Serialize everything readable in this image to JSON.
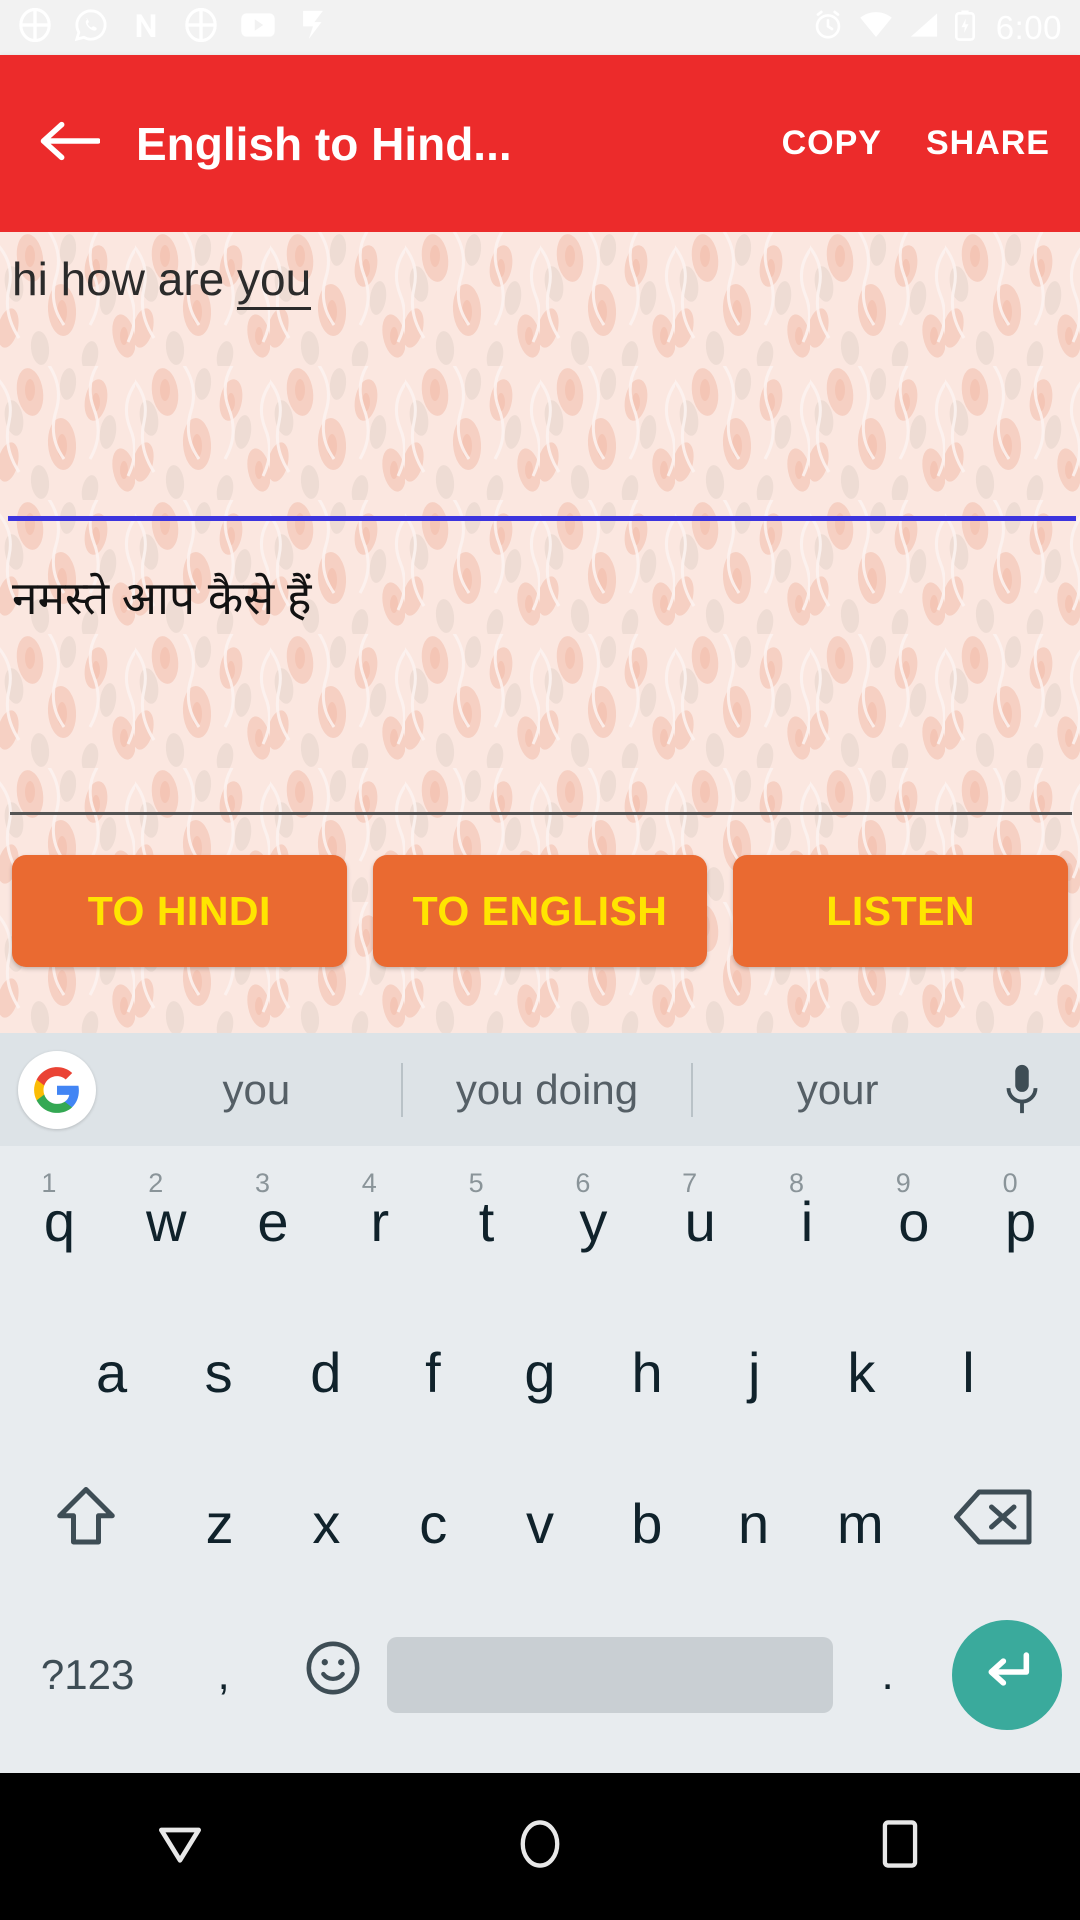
{
  "status_bar": {
    "time": "6:00",
    "notification_icons": [
      "apps-grid-icon",
      "whatsapp-icon",
      "letter-n-icon",
      "apps-grid-icon",
      "youtube-icon",
      "flipboard-icon"
    ],
    "system_icons": [
      "alarm-icon",
      "wifi-icon",
      "signal-icon",
      "battery-icon"
    ],
    "background_color": "#f2f2f2",
    "text_color": "#ffffff"
  },
  "app_bar": {
    "back_label": "back-arrow",
    "title": "English to Hind...",
    "copy_label": "COPY",
    "share_label": "SHARE",
    "background_color": "#ec2b2b",
    "text_color": "#ffffff"
  },
  "translator": {
    "source_text_before": "hi how are ",
    "source_text_composing": "you",
    "target_text": "नमस्ते आप कैसे हैं",
    "divider_color": "#3c34de",
    "bottom_divider_color": "#545454",
    "background_color": "#f9ded6",
    "buttons": [
      {
        "label": "TO HINDI",
        "name": "to-hindi-button"
      },
      {
        "label": "TO ENGLISH",
        "name": "to-english-button"
      },
      {
        "label": "LISTEN",
        "name": "listen-button"
      }
    ],
    "button_bg": "#ea6a31",
    "button_fg": "#ffe500"
  },
  "keyboard": {
    "suggestions": [
      "you",
      "you doing",
      "your"
    ],
    "google_logo": "google-g-icon",
    "mic": "microphone-icon",
    "row1": [
      {
        "key": "q",
        "num": "1"
      },
      {
        "key": "w",
        "num": "2"
      },
      {
        "key": "e",
        "num": "3"
      },
      {
        "key": "r",
        "num": "4"
      },
      {
        "key": "t",
        "num": "5"
      },
      {
        "key": "y",
        "num": "6"
      },
      {
        "key": "u",
        "num": "7"
      },
      {
        "key": "i",
        "num": "8"
      },
      {
        "key": "o",
        "num": "9"
      },
      {
        "key": "p",
        "num": "0"
      }
    ],
    "row2": [
      "a",
      "s",
      "d",
      "f",
      "g",
      "h",
      "j",
      "k",
      "l"
    ],
    "row3": [
      "z",
      "x",
      "c",
      "v",
      "b",
      "n",
      "m"
    ],
    "shift_label": "shift-icon",
    "backspace_label": "backspace-icon",
    "symbols_label": "?123",
    "comma_label": ",",
    "emoji_label": "emoji-icon",
    "space_label": "",
    "period_label": ".",
    "enter_label": "enter-icon",
    "enter_color": "#3aaa9c",
    "background_color": "#e8ecef",
    "suggestbar_color": "#dde3e7"
  },
  "nav_bar": {
    "back": "nav-back-triangle-icon",
    "home": "nav-home-circle-icon",
    "recents": "nav-recents-square-icon",
    "background_color": "#000000"
  }
}
